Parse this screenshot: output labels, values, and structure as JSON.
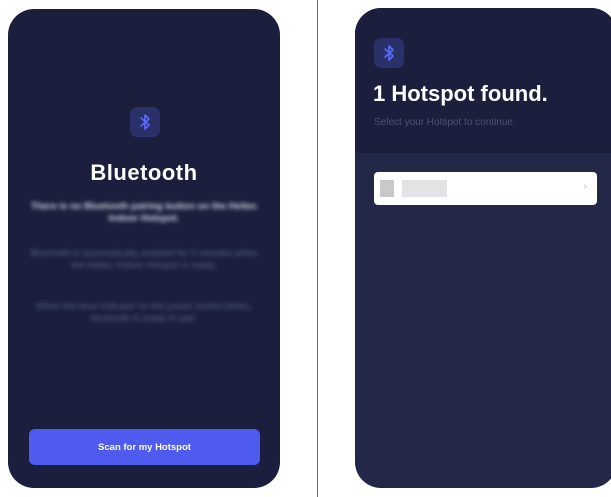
{
  "left_screen": {
    "icon": "bluetooth-icon",
    "title": "Bluetooth",
    "bold_note": "There is no Bluetooth pairing button on the Heltec Indoor Hotspot.",
    "paragraph_1": "Bluetooth is automatically enabled for 5 minutes when the Heltec Indoor Hotspot is ready.",
    "paragraph_2": "When the blue indicator on the power button blinks, bluetooth is ready to pair.",
    "scan_button_label": "Scan for my Hotspot"
  },
  "right_screen": {
    "icon": "bluetooth-icon",
    "title": "1 Hotspot found.",
    "subtitle": "Select your Hotspot to continue.",
    "hotspot_list": [
      {
        "name": "",
        "chevron": "chevron-right-icon"
      }
    ]
  },
  "colors": {
    "background": "#1b1f3d",
    "accent": "#4f5aef",
    "bluetooth_icon": "#5b6bff"
  }
}
